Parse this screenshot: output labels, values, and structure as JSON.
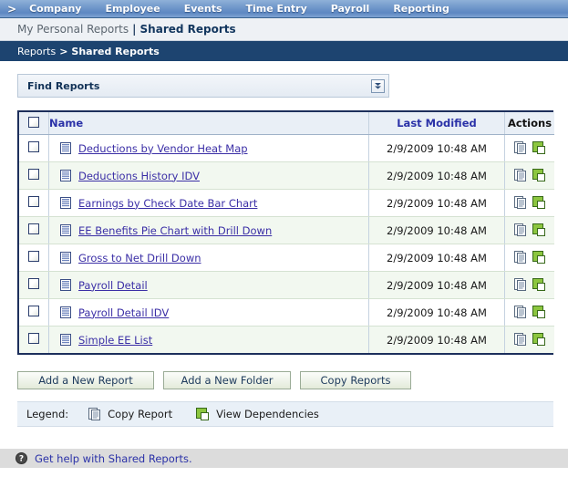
{
  "topnav": {
    "arrow_glyph": ">",
    "items": [
      {
        "label": "Company"
      },
      {
        "label": "Employee"
      },
      {
        "label": "Events"
      },
      {
        "label": "Time Entry"
      },
      {
        "label": "Payroll"
      },
      {
        "label": "Reporting"
      }
    ]
  },
  "subheader": {
    "personal_reports": "My Personal Reports",
    "separator": "|",
    "shared_reports": "Shared Reports"
  },
  "breadcrumb": {
    "root": "Reports",
    "separator": ">",
    "current": "Shared Reports"
  },
  "find_panel": {
    "title": "Find Reports",
    "expand_icon": "double-chevron-down-icon"
  },
  "table": {
    "headers": {
      "checkbox": "",
      "name": "Name",
      "last_modified": "Last Modified",
      "actions": "Actions"
    },
    "rows": [
      {
        "name": "Deductions by Vendor Heat Map",
        "last_modified": "2/9/2009 10:48 AM"
      },
      {
        "name": "Deductions History IDV",
        "last_modified": "2/9/2009 10:48 AM"
      },
      {
        "name": "Earnings by Check Date Bar Chart",
        "last_modified": "2/9/2009 10:48 AM"
      },
      {
        "name": "EE Benefits Pie Chart with Drill Down",
        "last_modified": "2/9/2009 10:48 AM"
      },
      {
        "name": "Gross to Net Drill Down",
        "last_modified": "2/9/2009 10:48 AM"
      },
      {
        "name": "Payroll Detail",
        "last_modified": "2/9/2009 10:48 AM"
      },
      {
        "name": "Payroll Detail IDV",
        "last_modified": "2/9/2009 10:48 AM"
      },
      {
        "name": "Simple EE List",
        "last_modified": "2/9/2009 10:48 AM"
      }
    ]
  },
  "buttons": {
    "add_report": "Add a New Report",
    "add_folder": "Add a New Folder",
    "copy_reports": "Copy Reports"
  },
  "legend": {
    "label": "Legend:",
    "copy_report": "Copy Report",
    "view_dependencies": "View Dependencies"
  },
  "footer": {
    "help_text": "Get help with Shared Reports.",
    "help_icon": "question-mark-circle-icon"
  },
  "colors": {
    "nav_blue": "#6b93c8",
    "breadcrumb_navy": "#1d4470",
    "link_blue": "#2b32a8",
    "table_border": "#1d2f5c",
    "row_alt": "#f2f8f0",
    "legend_bg": "#e9f0f7",
    "footer_bg": "#dcdcdc",
    "green_icon": "#8cc63f"
  }
}
